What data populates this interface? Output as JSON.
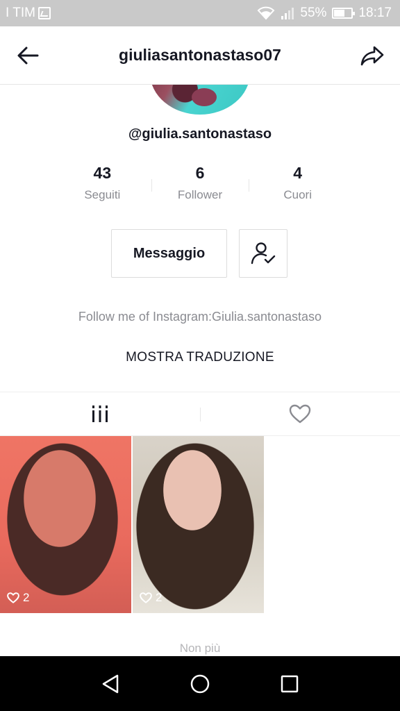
{
  "status_bar": {
    "carrier": "I TIM",
    "battery": "55%",
    "battery_level": 0.55,
    "time": "18:17"
  },
  "header": {
    "username": "giuliasantonastaso07"
  },
  "profile": {
    "handle": "@giulia.santonastaso",
    "stats": [
      {
        "value": "43",
        "label": "Seguiti"
      },
      {
        "value": "6",
        "label": "Follower"
      },
      {
        "value": "4",
        "label": "Cuori"
      }
    ],
    "message_label": "Messaggio",
    "bio": "Follow me of Instagram:Giulia.santonastaso",
    "translate_label": "MOSTRA TRADUZIONE"
  },
  "videos": [
    {
      "likes": "2"
    },
    {
      "likes": "2"
    }
  ],
  "footer_text": "Non più",
  "colors": {
    "text_primary": "#161823",
    "text_secondary": "#8a8b91",
    "status_bar_bg": "#c9c9c9",
    "nav_bar_bg": "#000000"
  }
}
